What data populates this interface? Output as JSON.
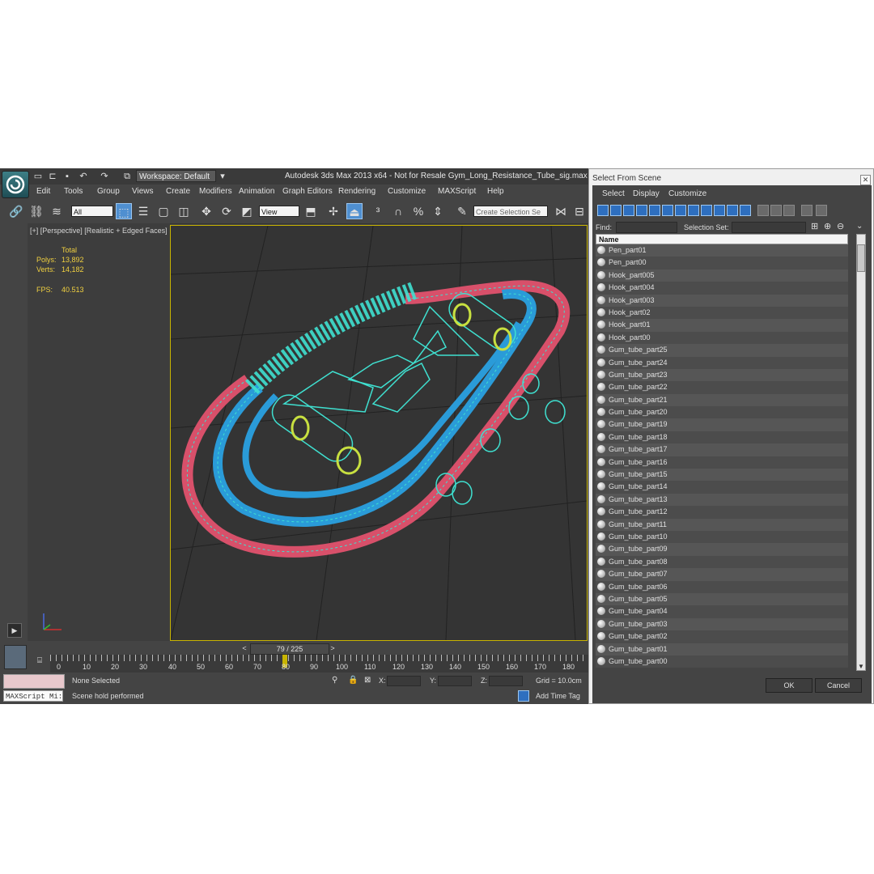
{
  "app": {
    "title": "Autodesk 3ds Max  2013 x64   - Not for Resale    Gym_Long_Resistance_Tube_sig.max",
    "workspace": "Workspace: Default",
    "menu": [
      "Edit",
      "Tools",
      "Group",
      "Views",
      "Create",
      "Modifiers",
      "Animation",
      "Graph Editors",
      "Rendering",
      "Customize",
      "MAXScript",
      "Help"
    ],
    "toolbar": {
      "filter_value": "All",
      "ref_coord": "View",
      "selection_set_placeholder": "Create Selection Se"
    }
  },
  "viewport": {
    "label": "[+] [Perspective] [Realistic + Edged Faces]",
    "stats": {
      "header": "Total",
      "polys_label": "Polys:",
      "polys_value": "13,892",
      "verts_label": "Verts:",
      "verts_value": "14,182",
      "fps_label": "FPS:",
      "fps_value": "40.513"
    }
  },
  "timeline": {
    "frame": "79 / 225",
    "prev": "<",
    "next": ">",
    "ticks": [
      "0",
      "10",
      "20",
      "30",
      "40",
      "50",
      "60",
      "70",
      "80",
      "90",
      "100",
      "110",
      "120",
      "130",
      "140",
      "150",
      "160",
      "170",
      "180"
    ]
  },
  "status": {
    "selection": "None Selected",
    "prompt": "Scene hold performed",
    "maxscript": "MAXScript Mi:",
    "x_label": "X:",
    "y_label": "Y:",
    "z_label": "Z:",
    "grid": "Grid = 10.0cm",
    "add_time_tag": "Add Time Tag"
  },
  "dialog": {
    "title": "Select From Scene",
    "menu": [
      "Select",
      "Display",
      "Customize"
    ],
    "find_label": "Find:",
    "selection_set_label": "Selection Set:",
    "column_header": "Name",
    "items": [
      "Pen_part01",
      "Pen_part00",
      "Hook_part005",
      "Hook_part004",
      "Hook_part003",
      "Hook_part02",
      "Hook_part01",
      "Hook_part00",
      "Gum_tube_part25",
      "Gum_tube_part24",
      "Gum_tube_part23",
      "Gum_tube_part22",
      "Gum_tube_part21",
      "Gum_tube_part20",
      "Gum_tube_part19",
      "Gum_tube_part18",
      "Gum_tube_part17",
      "Gum_tube_part16",
      "Gum_tube_part15",
      "Gum_tube_part14",
      "Gum_tube_part13",
      "Gum_tube_part12",
      "Gum_tube_part11",
      "Gum_tube_part10",
      "Gum_tube_part09",
      "Gum_tube_part08",
      "Gum_tube_part07",
      "Gum_tube_part06",
      "Gum_tube_part05",
      "Gum_tube_part04",
      "Gum_tube_part03",
      "Gum_tube_part02",
      "Gum_tube_part01",
      "Gum_tube_part00"
    ],
    "ok_label": "OK",
    "cancel_label": "Cancel"
  },
  "colors": {
    "wire_cyan": "#3fe0d0",
    "tube_red": "#d8506a",
    "tube_blue": "#2a9bd8",
    "handle_yellow": "#c8e040",
    "viewport_border": "#c8b400"
  }
}
